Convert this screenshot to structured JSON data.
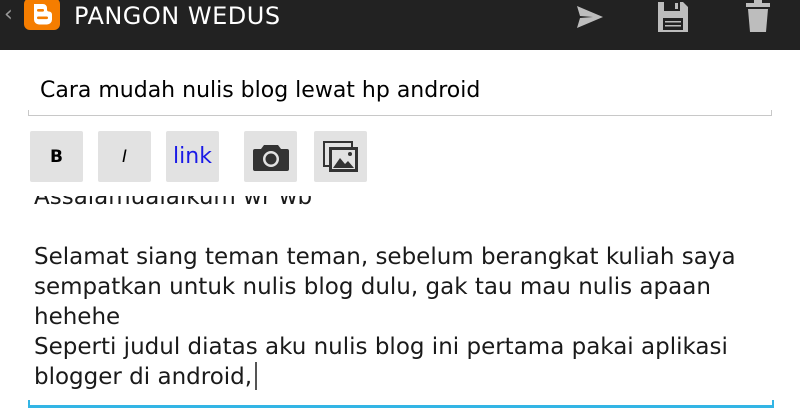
{
  "action_bar": {
    "title": "PANGON WEDUS",
    "back_glyph": "‹",
    "logo_icon": "blogger-logo-icon",
    "logo_color": "#f57d00",
    "actions": [
      {
        "icon": "send-icon",
        "label": "Publish"
      },
      {
        "icon": "save-icon",
        "label": "Save"
      },
      {
        "icon": "trash-icon",
        "label": "Delete"
      }
    ]
  },
  "post": {
    "title_value": "Cara mudah nulis blog lewat hp android",
    "body_partial_line": "Assalamualaikum wr wb",
    "body_lines": [
      "",
      "Selamat siang teman teman, sebelum berangkat kuliah saya sempatkan untuk nulis blog dulu, gak tau mau nulis apaan hehehe",
      "Seperti judul diatas aku nulis blog ini pertama pakai aplikasi blogger di android,"
    ]
  },
  "toolbar": {
    "bold_label": "B",
    "italic_label": "I",
    "link_label": "link",
    "camera_icon": "camera-icon",
    "gallery_icon": "image-gallery-icon"
  },
  "colors": {
    "action_bar_bg": "#222222",
    "accent": "#33b5e5",
    "link_text": "#1a1ae6",
    "button_bg": "#e2e2e2"
  }
}
